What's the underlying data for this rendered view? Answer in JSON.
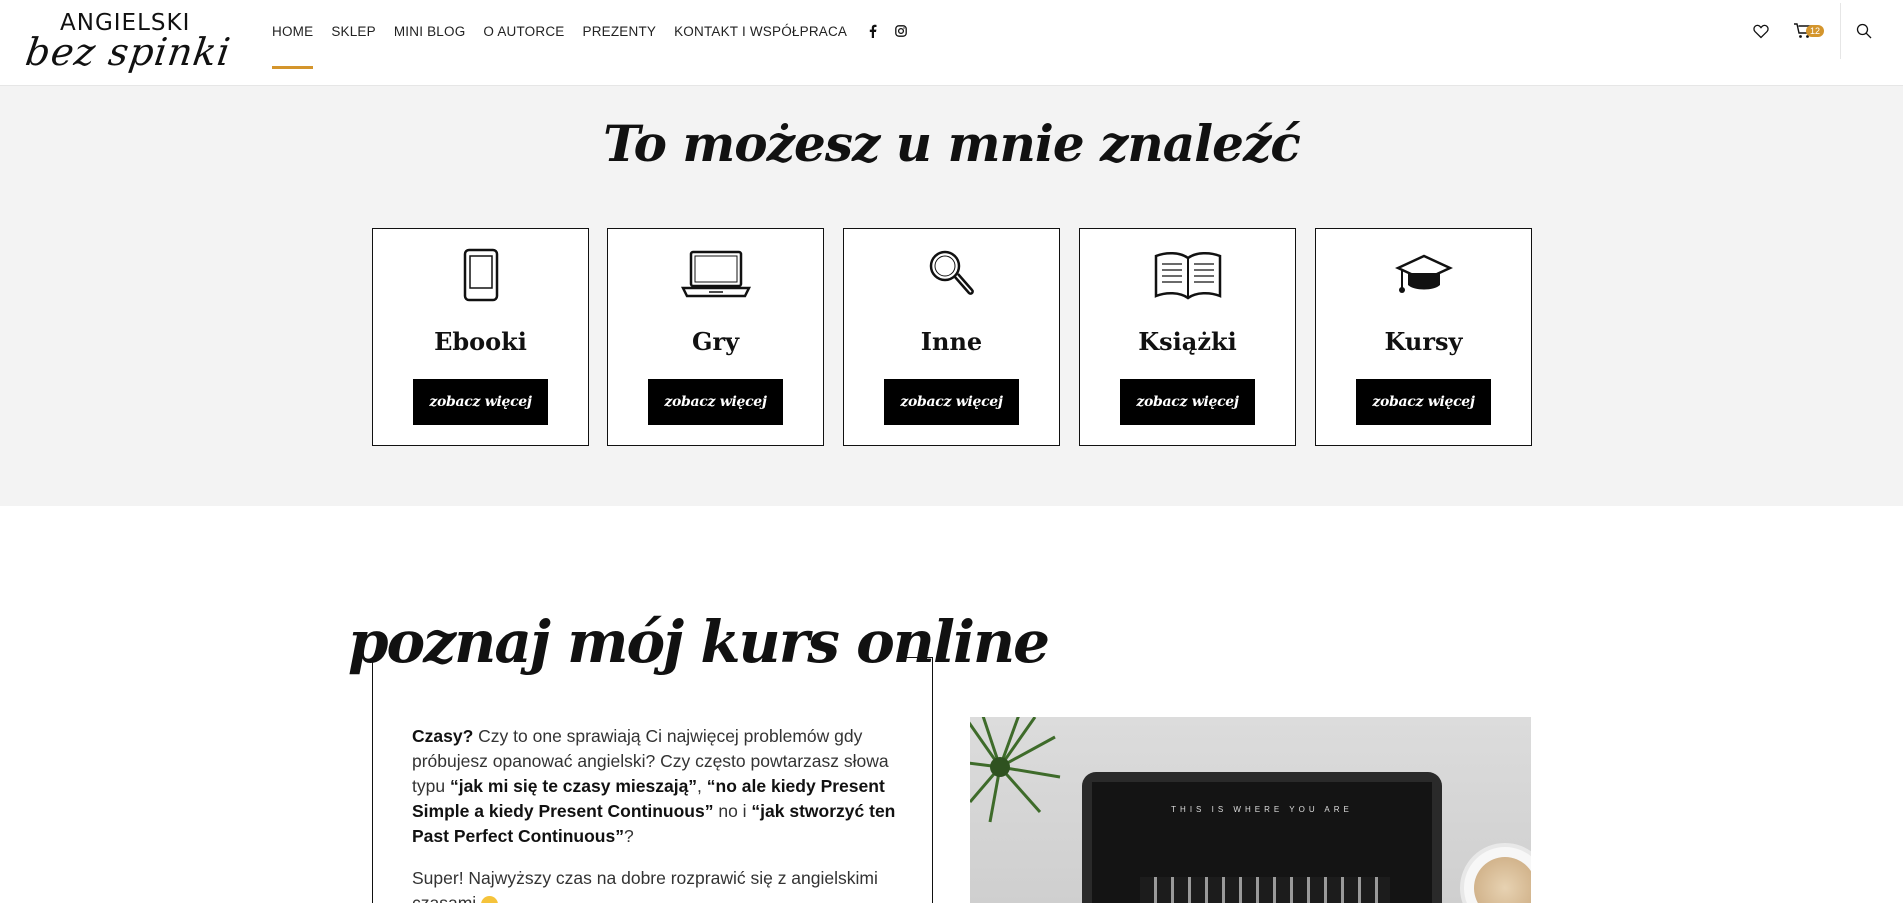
{
  "header": {
    "logo_top": "ANGIELSKI",
    "logo_script": "bez spinki",
    "nav": [
      "HOME",
      "SKLEP",
      "MINI BLOG",
      "O AUTORCE",
      "PREZENTY",
      "KONTAKT I WSPÓŁPRACA"
    ],
    "cart_count": "12",
    "accent_color": "#d4952c"
  },
  "categories": {
    "title": "To możesz u mnie znaleźć",
    "items": [
      {
        "label": "Ebooki",
        "button": "zobacz więcej",
        "icon": "ebook-icon"
      },
      {
        "label": "Gry",
        "button": "zobacz więcej",
        "icon": "laptop-icon"
      },
      {
        "label": "Inne",
        "button": "zobacz więcej",
        "icon": "magnifier-icon"
      },
      {
        "label": "Książki",
        "button": "zobacz więcej",
        "icon": "book-icon"
      },
      {
        "label": "Kursy",
        "button": "zobacz więcej",
        "icon": "graduation-cap-icon"
      }
    ]
  },
  "course": {
    "title": "poznaj mój kurs online",
    "p1_a": "Czasy?",
    "p1_b": " Czy to one sprawiają Ci najwięcej problemów gdy próbujesz opanować angielski? Czy często powtarzasz słowa typu ",
    "p1_c": "“jak mi się te czasy mieszają”",
    "p1_d": ", ",
    "p1_e": "“no ale kiedy Present Simple a kiedy Present Continuous”",
    "p1_f": " no i ",
    "p1_g": "“jak stworzyć ten Past Perfect Continuous”",
    "p1_h": "?",
    "p2": "Super! Najwyższy czas na dobre rozprawić się z angielskimi czasami",
    "photo_text": "THIS IS WHERE YOU ARE"
  }
}
